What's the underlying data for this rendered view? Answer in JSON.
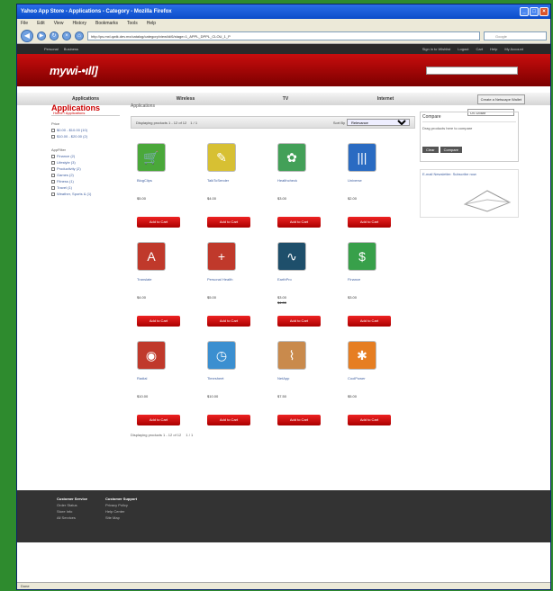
{
  "window": {
    "title": "Yahoo App Store - Applications - Category - Mozilla Firefox"
  },
  "menu": [
    "File",
    "Edit",
    "View",
    "History",
    "Bookmarks",
    "Tools",
    "Help"
  ],
  "address": {
    "url": "http://ps.mxl.qwik.dev.mx/catalog/category/view/id/6/stage=1_APPL_DPPL_CLOU_1_P",
    "search_placeholder": "Google"
  },
  "site": {
    "top_left": [
      "Personal",
      "Business"
    ],
    "top_right": [
      "Sign in to Wishlist",
      "Logout",
      "Cart",
      "Help",
      "My Account"
    ],
    "logo": "mywi-•ıll]",
    "nav": [
      "Applications",
      "Wireless",
      "TV",
      "Internet"
    ],
    "create_label": "Create a Netscape Wallet",
    "breadcrumb": "Home / Applications",
    "currency": "US Dollar"
  },
  "sidebar": {
    "title": "Applications",
    "price_label": "Price",
    "price_items": [
      "$0.00 - $10.00 (10)",
      "$10.00 - $20.00 (2)"
    ],
    "appfilter_label": "AppFilter",
    "app_items": [
      "Finance (2)",
      "Lifestyle (3)",
      "Productivity (2)",
      "Games (2)",
      "Fitness (1)",
      "Travel (1)",
      "Weather, Sports & (1)"
    ]
  },
  "main": {
    "heading": "Applications",
    "showing": "Displaying products 1 - 12 of 12",
    "page_info": "1 / 1",
    "sort_label": "Sort By",
    "sort_value": "Relevance",
    "add_label": "Add to Cart",
    "products": [
      {
        "name": "BlogClips",
        "price": "$5.00",
        "color": "#4aa83a",
        "icon": "cart"
      },
      {
        "name": "TalkToSender",
        "price": "$4.00",
        "color": "#d7c033",
        "icon": "chat"
      },
      {
        "name": "Healthcheck",
        "price": "$3.00",
        "color": "#43a058",
        "icon": "leaf"
      },
      {
        "name": "Universe",
        "price": "$2.00",
        "color": "#2a6bc2",
        "icon": "bars"
      },
      {
        "name": "Translate",
        "price": "$4.00",
        "color": "#c0392b",
        "icon": "text"
      },
      {
        "name": "Personal Health",
        "price": "$5.00",
        "color": "#c0392b",
        "icon": "plus"
      },
      {
        "name": "EarthPro",
        "price": "$3.00",
        "orig": "$4.00",
        "color": "#1e4f6b",
        "icon": "wave"
      },
      {
        "name": "Finance",
        "price": "$3.00",
        "color": "#38a04a",
        "icon": "money"
      },
      {
        "name": "Radial",
        "price": "$10.00",
        "color": "#c0392b",
        "icon": "circle"
      },
      {
        "name": "Timesheet",
        "price": "$10.00",
        "color": "#3b8fd0",
        "icon": "clock"
      },
      {
        "name": "NetApp",
        "price": "$7.50",
        "color": "#c98a4c",
        "icon": "tree"
      },
      {
        "name": "CoolPower",
        "price": "$5.00",
        "color": "#e67e22",
        "icon": "star"
      }
    ]
  },
  "compare": {
    "title": "Compare",
    "text": "Drag products here to compare",
    "clear": "Clear",
    "compare_btn": "Compare"
  },
  "newsletter": {
    "text": "E-mail Newsletter: Subscribe now"
  },
  "footer": [
    {
      "title": "Customer Service",
      "links": [
        "Order Status",
        "Store Info",
        "All Services"
      ]
    },
    {
      "title": "Customer Support",
      "links": [
        "Privacy Policy",
        "Help Center",
        "Site Map"
      ]
    }
  ],
  "status": "Done"
}
